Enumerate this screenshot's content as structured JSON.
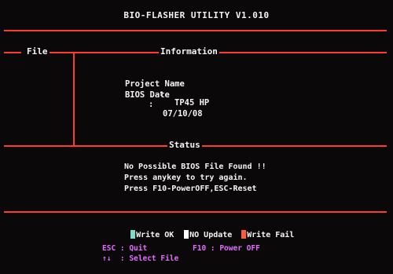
{
  "title": "BIO-FLASHER UTILITY V1.010",
  "sections": {
    "file": "File",
    "information": "Information",
    "status": "Status"
  },
  "information": {
    "project_label": "Project Name",
    "project_sep": ":",
    "project_value": "TP45 HP",
    "bios_label": "BIOS Date",
    "bios_sep": ":",
    "bios_value": "07/10/08"
  },
  "status": {
    "line1": "No Possible BIOS File Found !!",
    "line2": "Press anykey to try again.",
    "line3": "Press F10-PowerOFF,ESC-Reset"
  },
  "legend": {
    "write_ok": "Write OK",
    "no_update": "NO Update",
    "write_fail": "Write Fail",
    "colors": {
      "write_ok": "#7ed9c9",
      "no_update": "#ffffff",
      "write_fail": "#ff5a3a"
    }
  },
  "keys": {
    "esc": "ESC : Quit",
    "f10": "F10 : Power OFF",
    "select": "↑↓  : Select File"
  },
  "colors": {
    "border": "#ff3a2e",
    "text": "#f4f4f4",
    "key_text": "#e46bff",
    "background": "#0a0808"
  }
}
